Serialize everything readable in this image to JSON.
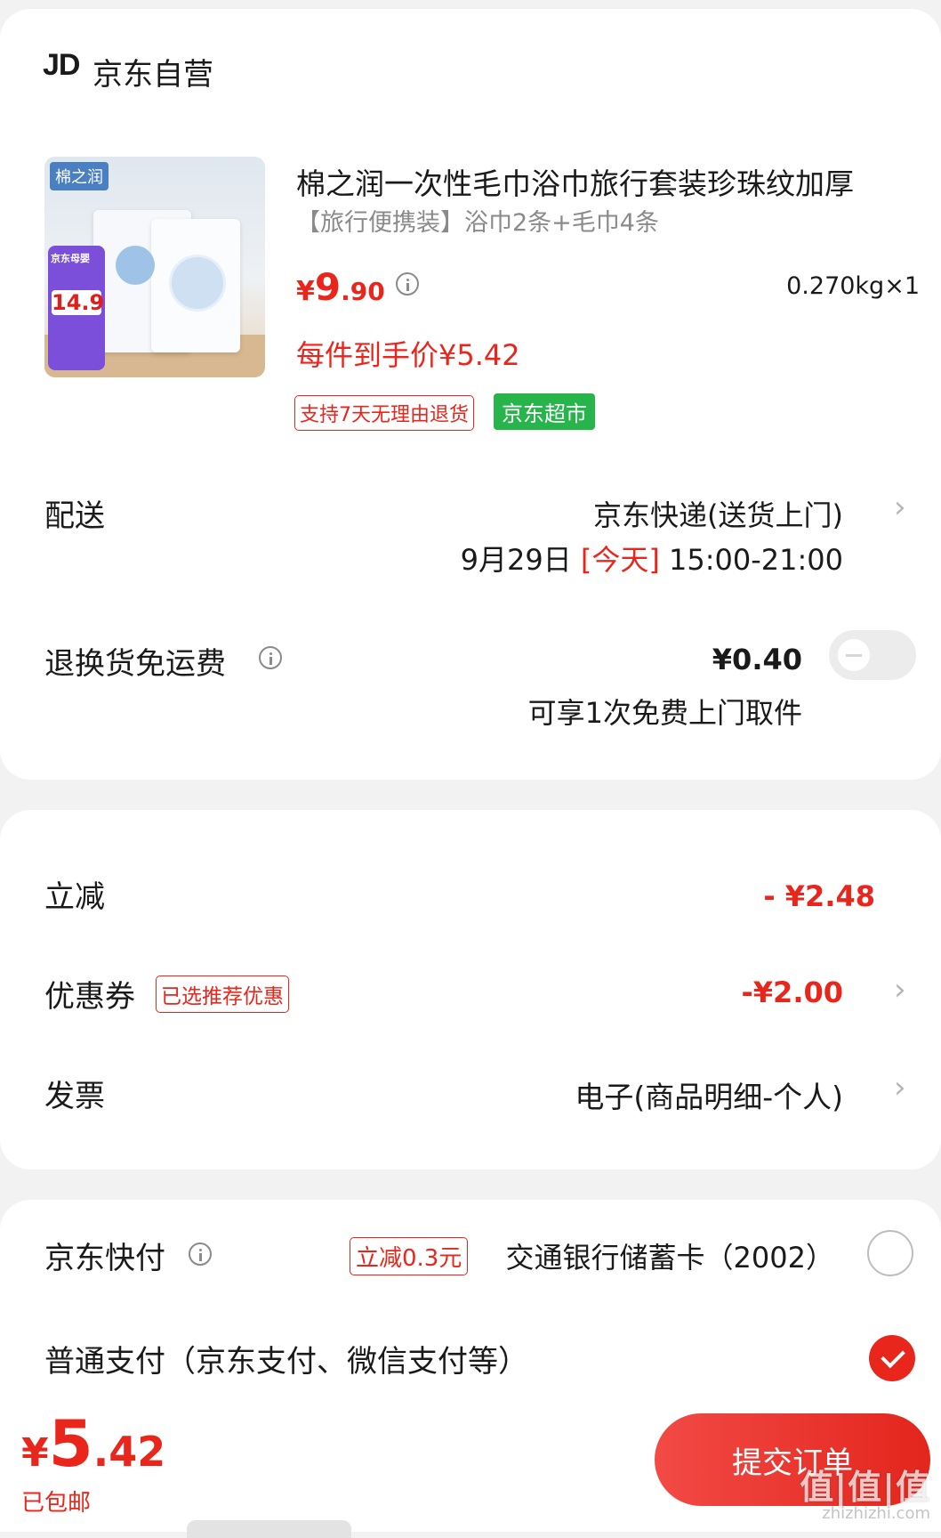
{
  "shop": {
    "logo_text": "JD",
    "name": "京东自营"
  },
  "product": {
    "image_brand": "棉之润",
    "image_promo": "京东母婴",
    "image_price": "14.9",
    "title": "棉之润一次性毛巾浴巾旅行套装珍珠纹加厚",
    "spec": "【旅行便携装】浴巾2条+毛巾4条",
    "price": {
      "symbol": "¥",
      "integer": "9",
      "decimal": ".90"
    },
    "weight_qty": "0.270kg×1",
    "per_item_price": "每件到手价¥5.42",
    "tags": {
      "return_policy": "支持7天无理由退货",
      "market": "京东超市"
    }
  },
  "delivery": {
    "label": "配送",
    "method": "京东快递(送货上门)",
    "date": "9月29日",
    "today": "[今天]",
    "time_range": "15:00-21:00"
  },
  "return_shipping": {
    "label": "退换货免运费",
    "price": "¥0.40",
    "note": "可享1次免费上门取件",
    "enabled": false
  },
  "discounts": {
    "instant": {
      "label": "立减",
      "value": "- ¥2.48"
    },
    "coupon": {
      "label": "优惠券",
      "tag": "已选推荐优惠",
      "value": "-¥2.00"
    },
    "invoice": {
      "label": "发票",
      "value": "电子(商品明细-个人)"
    }
  },
  "payment": {
    "quick_pay": {
      "label": "京东快付",
      "tag": "立减0.3元",
      "bank": "交通银行储蓄卡（2002）",
      "selected": false
    },
    "normal_pay": {
      "label": "普通支付（京东支付、微信支付等）",
      "selected": true
    }
  },
  "footer": {
    "total": {
      "symbol": "¥",
      "integer": "5",
      "decimal": ".42"
    },
    "shipping_note": "已包邮",
    "submit_label": "提交订单",
    "watermark": "值|值|值",
    "watermark_url": "zhizhizhi.com"
  },
  "colors": {
    "accent_red": "#e8261c",
    "market_green": "#26b44b",
    "toggle_off": "#ececec"
  }
}
